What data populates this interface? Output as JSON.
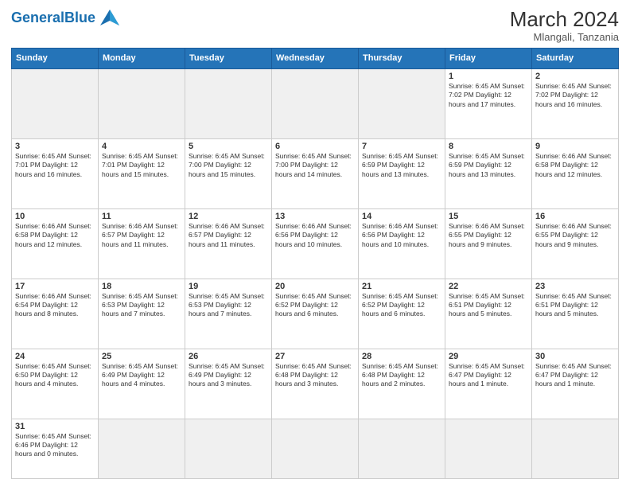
{
  "header": {
    "logo_general": "General",
    "logo_blue": "Blue",
    "month_year": "March 2024",
    "location": "Mlangali, Tanzania"
  },
  "days_of_week": [
    "Sunday",
    "Monday",
    "Tuesday",
    "Wednesday",
    "Thursday",
    "Friday",
    "Saturday"
  ],
  "weeks": [
    [
      {
        "day": "",
        "info": "",
        "empty": true
      },
      {
        "day": "",
        "info": "",
        "empty": true
      },
      {
        "day": "",
        "info": "",
        "empty": true
      },
      {
        "day": "",
        "info": "",
        "empty": true
      },
      {
        "day": "",
        "info": "",
        "empty": true
      },
      {
        "day": "1",
        "info": "Sunrise: 6:45 AM\nSunset: 7:02 PM\nDaylight: 12 hours\nand 17 minutes."
      },
      {
        "day": "2",
        "info": "Sunrise: 6:45 AM\nSunset: 7:02 PM\nDaylight: 12 hours\nand 16 minutes."
      }
    ],
    [
      {
        "day": "3",
        "info": "Sunrise: 6:45 AM\nSunset: 7:01 PM\nDaylight: 12 hours\nand 16 minutes."
      },
      {
        "day": "4",
        "info": "Sunrise: 6:45 AM\nSunset: 7:01 PM\nDaylight: 12 hours\nand 15 minutes."
      },
      {
        "day": "5",
        "info": "Sunrise: 6:45 AM\nSunset: 7:00 PM\nDaylight: 12 hours\nand 15 minutes."
      },
      {
        "day": "6",
        "info": "Sunrise: 6:45 AM\nSunset: 7:00 PM\nDaylight: 12 hours\nand 14 minutes."
      },
      {
        "day": "7",
        "info": "Sunrise: 6:45 AM\nSunset: 6:59 PM\nDaylight: 12 hours\nand 13 minutes."
      },
      {
        "day": "8",
        "info": "Sunrise: 6:45 AM\nSunset: 6:59 PM\nDaylight: 12 hours\nand 13 minutes."
      },
      {
        "day": "9",
        "info": "Sunrise: 6:46 AM\nSunset: 6:58 PM\nDaylight: 12 hours\nand 12 minutes."
      }
    ],
    [
      {
        "day": "10",
        "info": "Sunrise: 6:46 AM\nSunset: 6:58 PM\nDaylight: 12 hours\nand 12 minutes."
      },
      {
        "day": "11",
        "info": "Sunrise: 6:46 AM\nSunset: 6:57 PM\nDaylight: 12 hours\nand 11 minutes."
      },
      {
        "day": "12",
        "info": "Sunrise: 6:46 AM\nSunset: 6:57 PM\nDaylight: 12 hours\nand 11 minutes."
      },
      {
        "day": "13",
        "info": "Sunrise: 6:46 AM\nSunset: 6:56 PM\nDaylight: 12 hours\nand 10 minutes."
      },
      {
        "day": "14",
        "info": "Sunrise: 6:46 AM\nSunset: 6:56 PM\nDaylight: 12 hours\nand 10 minutes."
      },
      {
        "day": "15",
        "info": "Sunrise: 6:46 AM\nSunset: 6:55 PM\nDaylight: 12 hours\nand 9 minutes."
      },
      {
        "day": "16",
        "info": "Sunrise: 6:46 AM\nSunset: 6:55 PM\nDaylight: 12 hours\nand 9 minutes."
      }
    ],
    [
      {
        "day": "17",
        "info": "Sunrise: 6:46 AM\nSunset: 6:54 PM\nDaylight: 12 hours\nand 8 minutes."
      },
      {
        "day": "18",
        "info": "Sunrise: 6:45 AM\nSunset: 6:53 PM\nDaylight: 12 hours\nand 7 minutes."
      },
      {
        "day": "19",
        "info": "Sunrise: 6:45 AM\nSunset: 6:53 PM\nDaylight: 12 hours\nand 7 minutes."
      },
      {
        "day": "20",
        "info": "Sunrise: 6:45 AM\nSunset: 6:52 PM\nDaylight: 12 hours\nand 6 minutes."
      },
      {
        "day": "21",
        "info": "Sunrise: 6:45 AM\nSunset: 6:52 PM\nDaylight: 12 hours\nand 6 minutes."
      },
      {
        "day": "22",
        "info": "Sunrise: 6:45 AM\nSunset: 6:51 PM\nDaylight: 12 hours\nand 5 minutes."
      },
      {
        "day": "23",
        "info": "Sunrise: 6:45 AM\nSunset: 6:51 PM\nDaylight: 12 hours\nand 5 minutes."
      }
    ],
    [
      {
        "day": "24",
        "info": "Sunrise: 6:45 AM\nSunset: 6:50 PM\nDaylight: 12 hours\nand 4 minutes."
      },
      {
        "day": "25",
        "info": "Sunrise: 6:45 AM\nSunset: 6:49 PM\nDaylight: 12 hours\nand 4 minutes."
      },
      {
        "day": "26",
        "info": "Sunrise: 6:45 AM\nSunset: 6:49 PM\nDaylight: 12 hours\nand 3 minutes."
      },
      {
        "day": "27",
        "info": "Sunrise: 6:45 AM\nSunset: 6:48 PM\nDaylight: 12 hours\nand 3 minutes."
      },
      {
        "day": "28",
        "info": "Sunrise: 6:45 AM\nSunset: 6:48 PM\nDaylight: 12 hours\nand 2 minutes."
      },
      {
        "day": "29",
        "info": "Sunrise: 6:45 AM\nSunset: 6:47 PM\nDaylight: 12 hours\nand 1 minute."
      },
      {
        "day": "30",
        "info": "Sunrise: 6:45 AM\nSunset: 6:47 PM\nDaylight: 12 hours\nand 1 minute."
      }
    ],
    [
      {
        "day": "31",
        "info": "Sunrise: 6:45 AM\nSunset: 6:46 PM\nDaylight: 12 hours\nand 0 minutes.",
        "last": true
      },
      {
        "day": "",
        "info": "",
        "empty": true,
        "last": true
      },
      {
        "day": "",
        "info": "",
        "empty": true,
        "last": true
      },
      {
        "day": "",
        "info": "",
        "empty": true,
        "last": true
      },
      {
        "day": "",
        "info": "",
        "empty": true,
        "last": true
      },
      {
        "day": "",
        "info": "",
        "empty": true,
        "last": true
      },
      {
        "day": "",
        "info": "",
        "empty": true,
        "last": true
      }
    ]
  ]
}
